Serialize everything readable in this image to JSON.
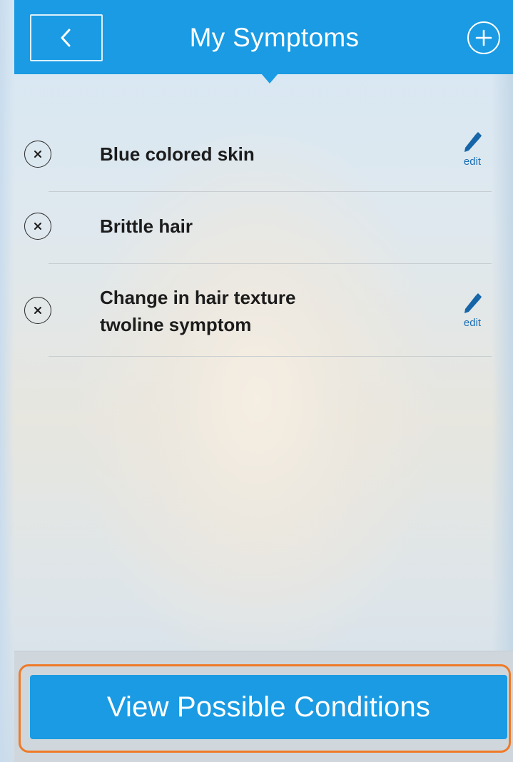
{
  "header": {
    "title": "My Symptoms",
    "back_icon": "chevron-left-icon",
    "add_icon": "plus-circle-icon",
    "color": "#1a9be3"
  },
  "symptoms": [
    {
      "label": "Blue colored skin",
      "remove_icon": "close-circle-icon",
      "editable": true,
      "edit_label": "edit",
      "edit_icon": "pencil-icon"
    },
    {
      "label": "Brittle hair",
      "remove_icon": "close-circle-icon",
      "editable": false
    },
    {
      "label": "Change in hair texture twoline symptom",
      "remove_icon": "close-circle-icon",
      "editable": true,
      "edit_label": "edit",
      "edit_icon": "pencil-icon"
    }
  ],
  "footer": {
    "button_label": "View Possible Conditions",
    "button_color": "#1a9be3",
    "highlight_color": "#ef7a28"
  }
}
